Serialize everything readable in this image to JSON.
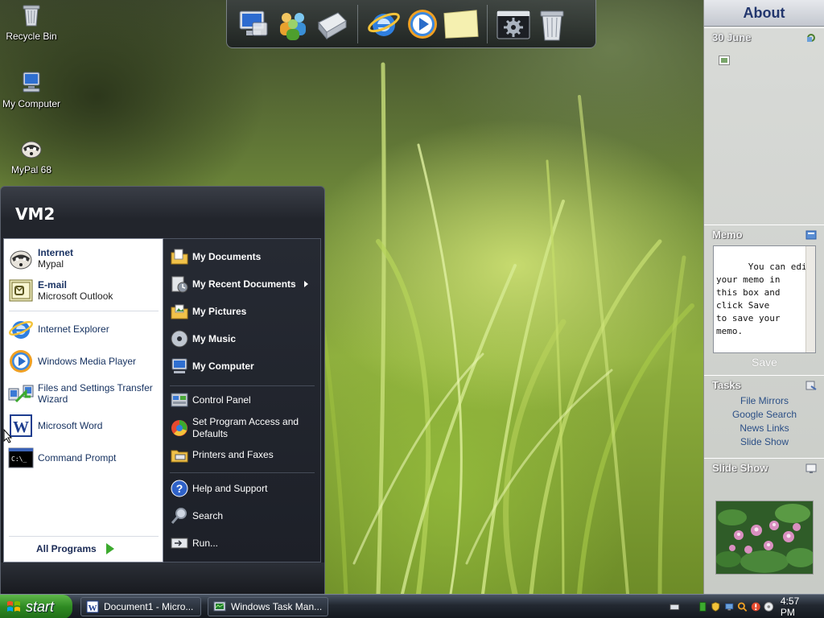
{
  "desktop": {
    "icons": [
      {
        "label": "Recycle Bin"
      },
      {
        "label": "My Computer"
      },
      {
        "label": "MyPal 68"
      }
    ]
  },
  "dock": {
    "items": [
      "my-computer-icon",
      "users-icon",
      "network-icon",
      "internet-explorer-icon",
      "media-player-icon",
      "sticky-note-icon",
      "settings-icon",
      "recycle-bin-icon"
    ]
  },
  "sidebar": {
    "title": "About",
    "date": "30 June",
    "memo": {
      "title": "Memo",
      "text": "You can edit\nyour memo in\nthis box and\nclick Save\nto save your\nmemo.",
      "save_label": "Save"
    },
    "tasks": {
      "title": "Tasks",
      "links": [
        "File Mirrors",
        "Google Search",
        "News Links",
        "Slide Show"
      ]
    },
    "slideshow": {
      "title": "Slide Show"
    }
  },
  "start_menu": {
    "user": "VM2",
    "pinned": [
      {
        "title": "Internet",
        "subtitle": "Mypal"
      },
      {
        "title": "E-mail",
        "subtitle": "Microsoft Outlook"
      }
    ],
    "recent": [
      {
        "label": "Internet Explorer"
      },
      {
        "label": "Windows Media Player"
      },
      {
        "label": "Files and Settings Transfer Wizard"
      },
      {
        "label": "Microsoft Word"
      },
      {
        "label": "Command Prompt"
      }
    ],
    "all_programs": "All Programs",
    "right": {
      "my_documents": "My Documents",
      "my_recent_documents": "My Recent Documents",
      "my_pictures": "My Pictures",
      "my_music": "My Music",
      "my_computer": "My Computer",
      "control_panel": "Control Panel",
      "set_program_access": "Set Program Access and Defaults",
      "printers_faxes": "Printers and Faxes",
      "help_support": "Help and Support",
      "search": "Search",
      "run": "Run..."
    }
  },
  "taskbar": {
    "start_label": "start",
    "tasks": [
      {
        "label": "Document1 - Micro..."
      },
      {
        "label": "Windows Task Man..."
      }
    ],
    "clock": "4:57 PM"
  },
  "colors": {
    "start_green": "#2f8a23",
    "start_menu_dark": "#1d2028",
    "sidebar_bg": "#c8cbc6",
    "link_blue": "#2b4f86"
  }
}
